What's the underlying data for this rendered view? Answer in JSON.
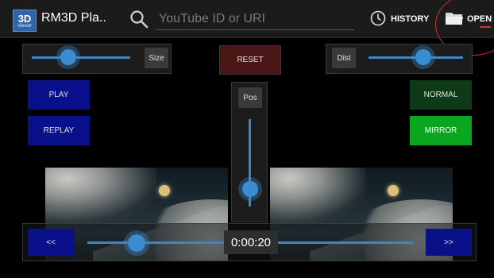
{
  "app": {
    "logo_big": "3D",
    "logo_small": "Viewer",
    "title": "RM3D Pla.."
  },
  "search": {
    "placeholder": "YouTube ID or URI",
    "value": ""
  },
  "actions": {
    "history_label": "HISTORY",
    "open_label": "OPEN"
  },
  "size_control": {
    "label": "Size",
    "level": 0.37
  },
  "dist_control": {
    "label": "Dist",
    "level": 0.58
  },
  "pos_control": {
    "label": "Pos",
    "level": 0.2
  },
  "buttons": {
    "reset": "RESET",
    "play": "PLAY",
    "replay": "REPLAY",
    "normal": "NORMAL",
    "mirror": "MIRROR"
  },
  "playback": {
    "rewind": "<<",
    "forward": ">>",
    "time": "0:00:20",
    "progress": 0.15
  },
  "colors": {
    "accent": "#3a8dd0",
    "play_blue": "#0a0f8a",
    "mirror_green": "#0aa61f",
    "normal_green": "#0f3a17",
    "reset_red": "#4a1616",
    "annotation_red": "#d0312d"
  },
  "icons": {
    "search": "search-icon",
    "history": "clock-icon",
    "open": "folder-icon"
  }
}
